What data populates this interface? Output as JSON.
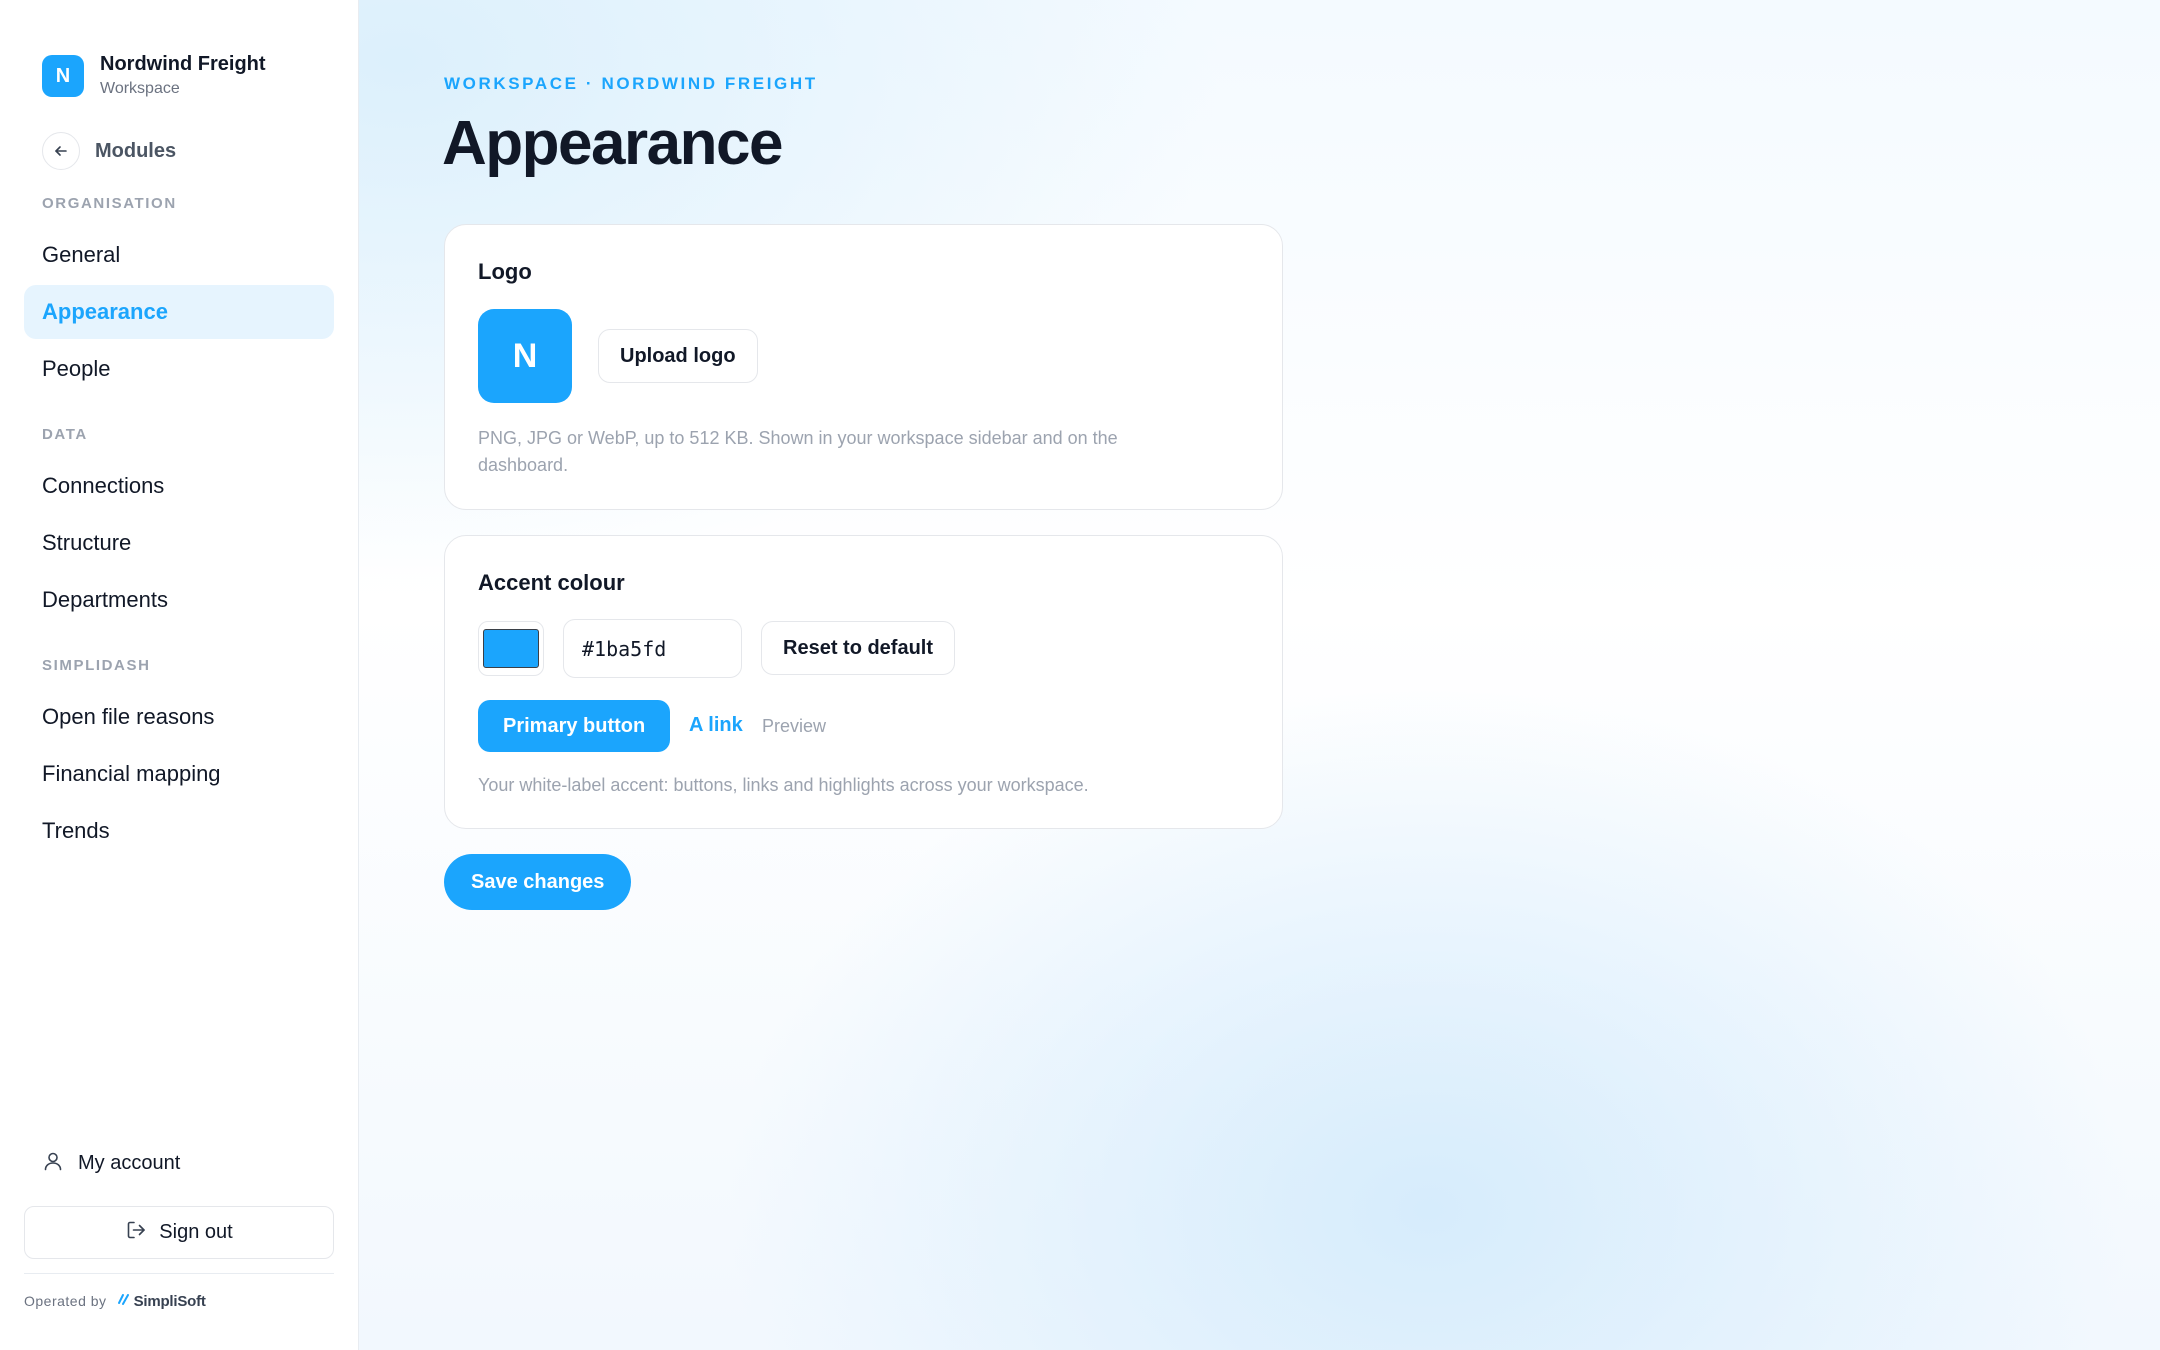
{
  "brand": {
    "initial": "N",
    "name": "Nordwind Freight",
    "subtitle": "Workspace"
  },
  "back": {
    "label": "Modules",
    "icon": "arrow-left-icon"
  },
  "sidebar": {
    "sections": [
      {
        "label": "ORGANISATION",
        "items": [
          {
            "label": "General",
            "active": false
          },
          {
            "label": "Appearance",
            "active": true
          },
          {
            "label": "People",
            "active": false
          }
        ]
      },
      {
        "label": "DATA",
        "items": [
          {
            "label": "Connections",
            "active": false
          },
          {
            "label": "Structure",
            "active": false
          },
          {
            "label": "Departments",
            "active": false
          }
        ]
      },
      {
        "label": "SIMPLIDASH",
        "items": [
          {
            "label": "Open file reasons",
            "active": false
          },
          {
            "label": "Financial mapping",
            "active": false
          },
          {
            "label": "Trends",
            "active": false
          }
        ]
      }
    ],
    "account_label": "My account",
    "signout_label": "Sign out",
    "operated_by": "Operated by",
    "operator_name": "SimpliSoft"
  },
  "main": {
    "eyebrow": "WORKSPACE · NORDWIND FREIGHT",
    "title": "Appearance",
    "logo_card": {
      "title": "Logo",
      "logo_initial": "N",
      "upload_label": "Upload logo",
      "help": "PNG, JPG or WebP, up to 512 KB. Shown in your workspace sidebar and on the dashboard."
    },
    "accent_card": {
      "title": "Accent colour",
      "hex_value": "#1ba5fd",
      "reset_label": "Reset to default",
      "primary_button_label": "Primary button",
      "link_label": "A link",
      "preview_label": "Preview",
      "help": "Your white-label accent: buttons, links and highlights across your workspace."
    },
    "save_label": "Save changes"
  },
  "colors": {
    "accent": "#1ba5fd",
    "active_bg": "#e6f4fe",
    "text": "#111827",
    "muted": "#9ca3af"
  }
}
